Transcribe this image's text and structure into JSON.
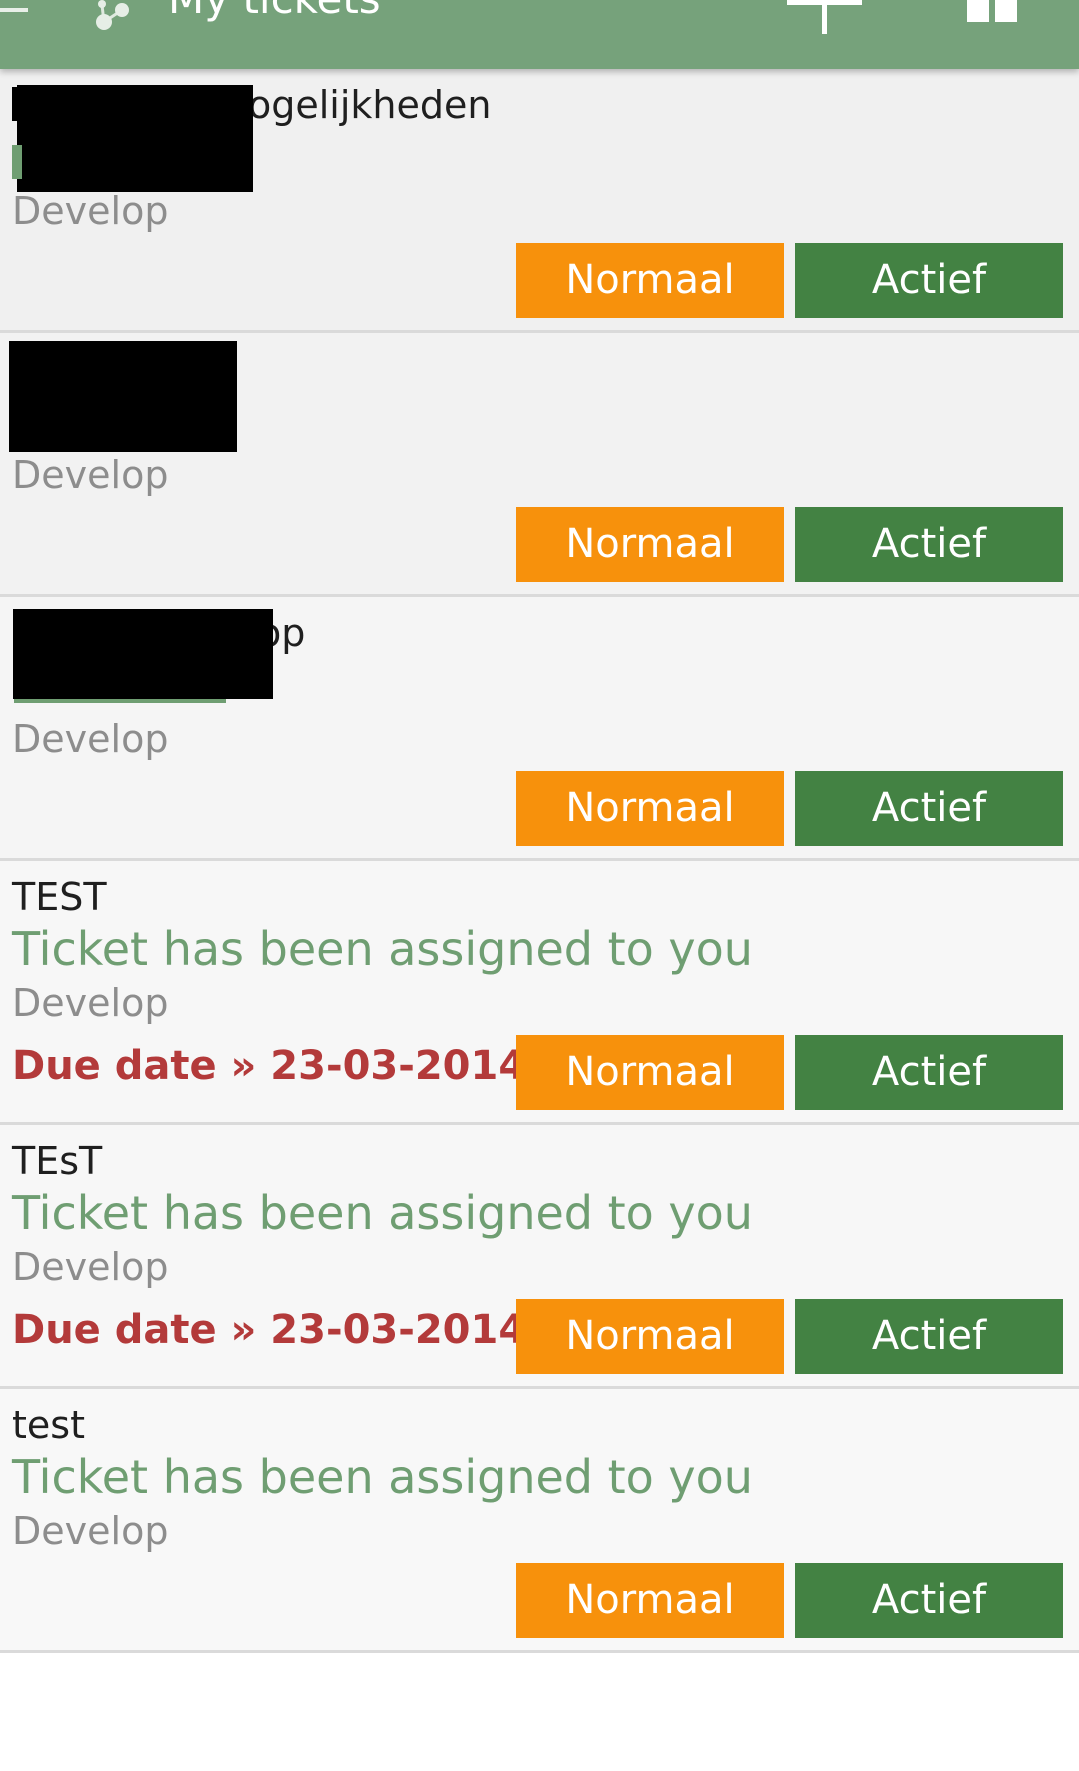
{
  "header": {
    "title": "My tickets",
    "background": "#76a27b",
    "menu_icon": "menu-icon",
    "logo_icon": "app-logo-icon",
    "add_icon": "plus-icon",
    "view_icon": "grid-icon"
  },
  "colors": {
    "priority_button": "#f7910c",
    "state_button": "#438243",
    "status_text": "#6f9e72",
    "due_date_text": "#b33a3a",
    "project_text": "#8d8d8d"
  },
  "tickets": [
    {
      "title": "ogelijkheden",
      "status": "",
      "project": "Develop",
      "due_date": "",
      "priority": "Normaal",
      "state": "Actief"
    },
    {
      "title": "",
      "status": "",
      "project": "Develop",
      "due_date": "",
      "priority": "Normaal",
      "state": "Actief"
    },
    {
      "title": "op",
      "status": "",
      "project": "Develop",
      "due_date": "",
      "priority": "Normaal",
      "state": "Actief"
    },
    {
      "title": "TEST",
      "status": "Ticket has been assigned to you",
      "project": "Develop",
      "due_date": "Due date » 23-03-2014",
      "priority": "Normaal",
      "state": "Actief"
    },
    {
      "title": "TEsT",
      "status": "Ticket has been assigned to you",
      "project": "Develop",
      "due_date": "Due date » 23-03-2014",
      "priority": "Normaal",
      "state": "Actief"
    },
    {
      "title": "test",
      "status": "Ticket has been assigned to you",
      "project": "Develop",
      "due_date": "",
      "priority": "Normaal",
      "state": "Actief"
    }
  ]
}
